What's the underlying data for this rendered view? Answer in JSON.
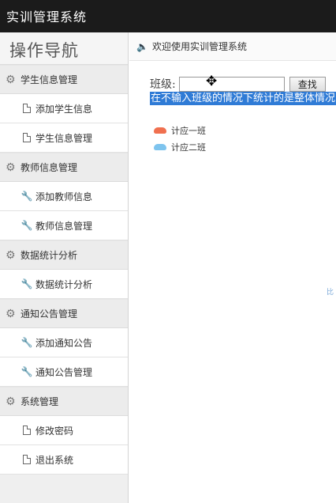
{
  "app": {
    "title": "实训管理系统"
  },
  "sidebar": {
    "title": "操作导航",
    "groups": [
      {
        "label": "学生信息管理",
        "items": [
          {
            "label": "添加学生信息",
            "icon": "document-icon"
          },
          {
            "label": "学生信息管理",
            "icon": "document-icon"
          }
        ]
      },
      {
        "label": "教师信息管理",
        "items": [
          {
            "label": "添加教师信息",
            "icon": "wrench-icon"
          },
          {
            "label": "教师信息管理",
            "icon": "wrench-icon"
          }
        ]
      },
      {
        "label": "数据统计分析",
        "items": [
          {
            "label": "数据统计分析",
            "icon": "wrench-icon"
          }
        ]
      },
      {
        "label": "通知公告管理",
        "items": [
          {
            "label": "添加通知公告",
            "icon": "wrench-icon"
          },
          {
            "label": "通知公告管理",
            "icon": "wrench-icon"
          }
        ]
      },
      {
        "label": "系统管理",
        "items": [
          {
            "label": "修改密码",
            "icon": "document-icon"
          },
          {
            "label": "退出系统",
            "icon": "document-icon"
          }
        ]
      }
    ]
  },
  "main": {
    "welcome": "欢迎使用实训管理系统",
    "search": {
      "label": "班级:",
      "value": "",
      "button": "查找"
    },
    "hint": "在不输入班级的情况下统计的是整体情况",
    "legend": [
      {
        "label": "计应一班",
        "color": "#f0704f"
      },
      {
        "label": "计应二班",
        "color": "#7ec4ee"
      }
    ],
    "edge_mark": "比"
  }
}
